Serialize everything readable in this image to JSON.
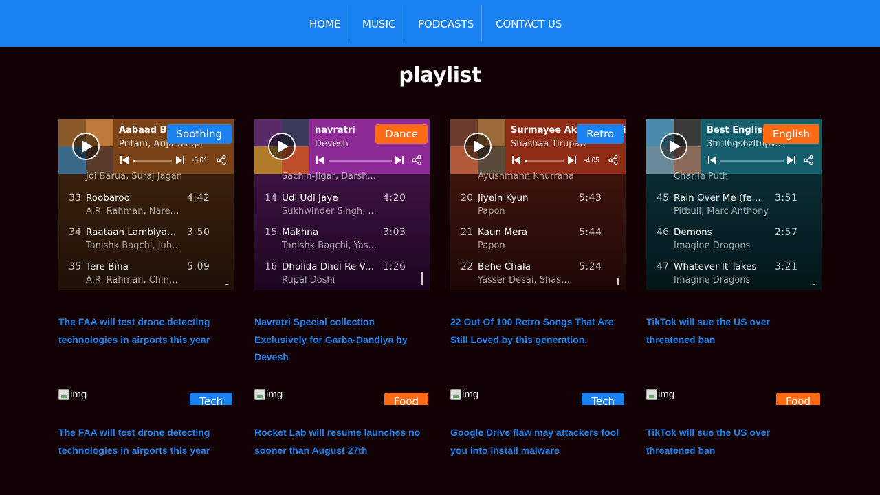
{
  "nav": {
    "items": [
      {
        "label": "HOME"
      },
      {
        "label": "MUSIC"
      },
      {
        "label": "PODCASTS"
      },
      {
        "label": "CONTACT US"
      }
    ]
  },
  "page": {
    "title": "playlist"
  },
  "colors": {
    "nav_bg": "#1a82f0",
    "page_bg": "#120204",
    "link": "#1a82f0",
    "badge_blue": "#1a82f0",
    "badge_orange": "#ff6a14"
  },
  "playlists": [
    {
      "title": "Aabaad Barbaad",
      "artist": "Pritam, Arijit Singh",
      "tag": "Soothing",
      "time_left": "-5:01",
      "progress": 0.05,
      "top_artist": "Joi Barua, Suraj Jagan",
      "tracks": [
        {
          "num": "33",
          "name": "Roobaroo",
          "artists": "A.R. Rahman, Naresh...",
          "duration": "4:42"
        },
        {
          "num": "34",
          "name": "Raataan Lambiyan (F...",
          "artists": "Tanishk Bagchi, Jubi...",
          "duration": "3:50"
        },
        {
          "num": "35",
          "name": "Tere Bina",
          "artists": "A.R. Rahman, Chinm...",
          "duration": "5:09"
        }
      ]
    },
    {
      "title": "navratri",
      "artist": "Devesh",
      "tag": "Dance",
      "time_left": "",
      "progress": 0,
      "top_artist": "Sachin-Jigar, Darsh...",
      "tracks": [
        {
          "num": "14",
          "name": "Udi Udi Jaye",
          "artists": "Sukhwinder Singh, ...",
          "duration": "4:20"
        },
        {
          "num": "15",
          "name": "Makhna",
          "artists": "Tanishk Bagchi, Yas...",
          "duration": "3:03"
        },
        {
          "num": "16",
          "name": "Dholida Dhol Re Va...",
          "artists": "Rupal Doshi",
          "duration": "1:26"
        }
      ]
    },
    {
      "title": "Surmayee Akhiyon Mein",
      "artist": "Shashaa Tirupati",
      "tag": "Retro",
      "time_left": "-4:05",
      "progress": 0.05,
      "top_artist": "Ayushmann Khurrana",
      "tracks": [
        {
          "num": "20",
          "name": "Jiyein Kyun",
          "artists": "Papon",
          "duration": "5:43"
        },
        {
          "num": "21",
          "name": "Kaun Mera",
          "artists": "Papon",
          "duration": "5:44"
        },
        {
          "num": "22",
          "name": "Behe Chala",
          "artists": "Yasser Desai, Shash...",
          "duration": "5:24"
        }
      ]
    },
    {
      "title": "Best English songs",
      "artist": "3fml6gs6zltnpv...",
      "tag": "English",
      "time_left": "",
      "progress": 0,
      "top_artist": "Charlie Puth",
      "tracks": [
        {
          "num": "45",
          "name": "Rain Over Me (feat. ...",
          "artists": "Pitbull, Marc Anthony",
          "duration": "3:51"
        },
        {
          "num": "46",
          "name": "Demons",
          "artists": "Imagine Dragons",
          "duration": "2:57"
        },
        {
          "num": "47",
          "name": "Whatever It Takes",
          "artists": "Imagine Dragons",
          "duration": "3:21"
        }
      ]
    }
  ],
  "captions_top": [
    "The FAA will test drone detecting technologies in airports this year",
    "Navratri Special collection Exclusively for Garba-Dandiya by Devesh",
    "22 Out Of 100 Retro Songs That Are Still Loved by this generation.",
    "TikTok will sue the US over threatened ban"
  ],
  "articles": [
    {
      "img_alt": "img",
      "tag": "Tech",
      "title": "The FAA will test drone detecting technologies in airports this year"
    },
    {
      "img_alt": "img",
      "tag": "Food",
      "title": "Rocket Lab will resume launches no sooner than August 27th"
    },
    {
      "img_alt": "img",
      "tag": "Tech",
      "title": "Google Drive flaw may attackers fool you into install malware"
    },
    {
      "img_alt": "img",
      "tag": "Food",
      "title": "TikTok will sue the US over threatened ban"
    }
  ]
}
